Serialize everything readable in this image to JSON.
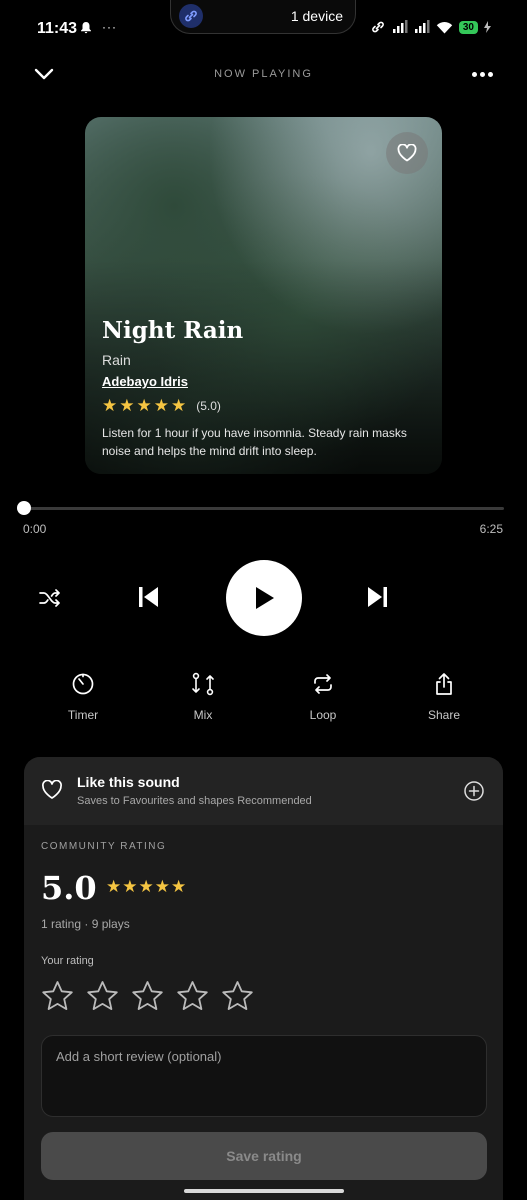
{
  "status_bar": {
    "time": "11:43",
    "island_text": "1 device",
    "battery": "30",
    "icons": [
      "bell-icon",
      "more-dots-icon",
      "link-icon",
      "signal-icon",
      "signal-icon",
      "wifi-icon",
      "battery-icon",
      "charging-icon"
    ]
  },
  "header": {
    "title": "NOW PLAYING",
    "back_icon": "chevron-down-icon",
    "menu_icon": "more-horizontal-icon"
  },
  "track": {
    "title": "Night Rain",
    "category": "Rain",
    "author": "Adebayo Idris",
    "stars": 5,
    "rating_text": "(5.0)",
    "description": "Listen for 1 hour if you have insomnia. Steady rain masks noise and helps the mind drift into sleep."
  },
  "progress": {
    "current": "0:00",
    "duration": "6:25",
    "fraction": 0
  },
  "controls": {
    "shuffle_icon": "shuffle-icon",
    "prev_icon": "skip-previous-icon",
    "play_icon": "play-icon",
    "next_icon": "skip-next-icon"
  },
  "actions": [
    {
      "label": "Timer",
      "icon": "timer-icon"
    },
    {
      "label": "Mix",
      "icon": "mix-icon"
    },
    {
      "label": "Loop",
      "icon": "loop-icon"
    },
    {
      "label": "Share",
      "icon": "share-icon"
    }
  ],
  "like": {
    "title": "Like this sound",
    "subtitle": "Saves to Favourites and shapes Recommended"
  },
  "community": {
    "label": "COMMUNITY RATING",
    "score": "5.0",
    "stars": 5,
    "meta": "1 rating · 9 plays"
  },
  "your_rating": {
    "label": "Your rating",
    "selected": 0,
    "max": 5
  },
  "review": {
    "placeholder": "Add a short review (optional)"
  },
  "save_label": "Save rating",
  "colors": {
    "star": "#f5c542",
    "background": "#000000",
    "sheet": "#1b1b1b",
    "battery": "#34c759"
  }
}
